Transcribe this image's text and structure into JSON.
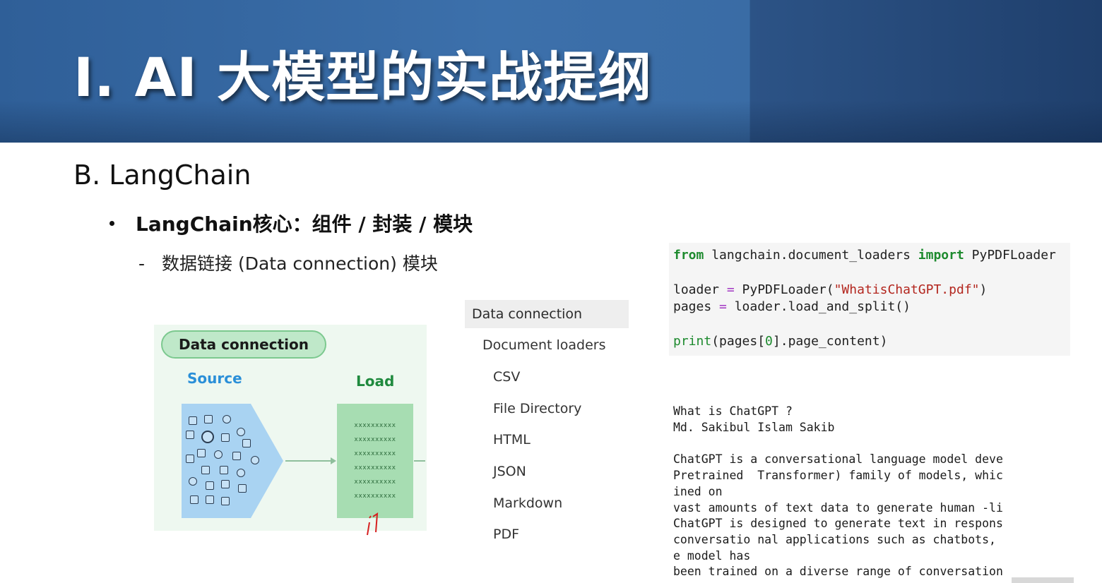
{
  "banner": {
    "title": "I. AI 大模型的实战提纲"
  },
  "section": {
    "title": "B. LangChain"
  },
  "bullet": {
    "text": "LangChain核心：组件 / 封装 / 模块"
  },
  "sub": {
    "dash": "-",
    "text": "数据链接 (Data connection) 模块"
  },
  "diagram": {
    "pill": "Data connection",
    "source_label": "Source",
    "load_label": "Load",
    "load_rows": [
      "xxxxxxxxxx",
      "xxxxxxxxxx",
      "xxxxxxxxxx",
      "xxxxxxxxxx",
      "xxxxxxxxxx",
      "xxxxxxxxxx"
    ]
  },
  "sidebar": {
    "head": "Data connection",
    "items": [
      "Document loaders",
      "CSV",
      "File Directory",
      "HTML",
      "JSON",
      "Markdown",
      "PDF"
    ]
  },
  "code": {
    "line1": {
      "kw1": "from",
      "mid": " langchain.document_loaders ",
      "kw2": "import",
      "rest": " PyPDFLoader"
    },
    "line2": {
      "a": "loader ",
      "op": "=",
      "b": " PyPDFLoader(",
      "str": "\"WhatisChatGPT.pdf\"",
      "c": ")"
    },
    "line3": {
      "a": "pages ",
      "op": "=",
      "b": " loader.load_and_split()"
    },
    "line4": {
      "fn": "print",
      "a": "(pages[",
      "num": "0",
      "b": "].page_content)"
    }
  },
  "output": {
    "lines": [
      "What is ChatGPT ?",
      "Md. Sakibul Islam Sakib",
      "",
      "ChatGPT is a conversational language model deve",
      "Pretrained  Transformer) family of models, whic",
      "ined on",
      "vast amounts of text data to generate human -li",
      "ChatGPT is designed to generate text in respons",
      "conversatio nal applications such as chatbots,",
      "e model has",
      "been trained on a diverse range of conversation"
    ]
  }
}
